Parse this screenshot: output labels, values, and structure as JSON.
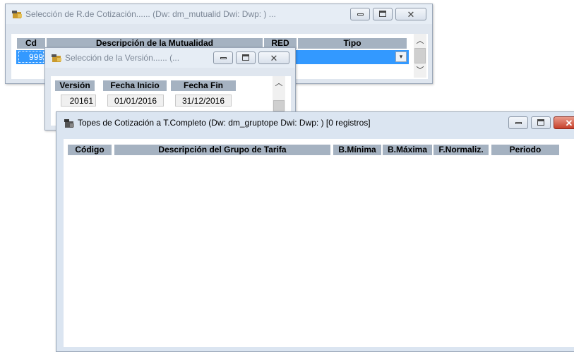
{
  "win1": {
    "title": "Selección de R.de Cotización...... (Dw: dm_mutualid Dwi:  Dwp: )    ...",
    "columns": [
      "Cd",
      "Descripción de la Mutualidad",
      "RED",
      "Tipo"
    ],
    "row": {
      "cd": "999"
    }
  },
  "win2": {
    "title": "Selección de la Versión...... (...",
    "columns": [
      "Versión",
      "Fecha Inicio",
      "Fecha Fin"
    ],
    "row": {
      "version": "20161",
      "fecha_inicio": "01/01/2016",
      "fecha_fin": "31/12/2016"
    }
  },
  "win3": {
    "title": "Topes de Cotización a T.Completo (Dw: dm_gruptope Dwi:  Dwp: )     [0 registros]",
    "columns": [
      "Código",
      "Descripción del Grupo de Tarifa",
      "B.Mínima",
      "B.Máxima",
      "F.Normaliz.",
      "Periodo"
    ]
  },
  "icons": {
    "app": "window-app-icon",
    "minimize": "minimize-icon",
    "maximize": "maximize-icon",
    "close": "close-icon",
    "scroll_up": "chevron-up-icon",
    "scroll_down": "chevron-down-icon",
    "dropdown": "chevron-down-icon"
  },
  "colors": {
    "selection": "#3399ff",
    "header": "#a5b2c1",
    "titlebar": "#dbe5f1",
    "close_active": "#c6402a"
  }
}
